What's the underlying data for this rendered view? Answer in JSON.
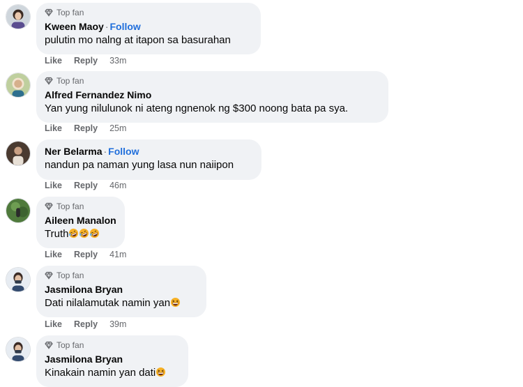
{
  "badge_label": "Top fan",
  "like_label": "Like",
  "reply_label": "Reply",
  "follow_label": "Follow",
  "follow_separator": "·",
  "colors": {
    "bubble": "#f0f2f5",
    "link": "#216fdb",
    "meta": "#65676b",
    "text": "#050505"
  },
  "comments": [
    {
      "name": "Kween Maoy",
      "top_fan": true,
      "follow": true,
      "text": "pulutin mo nalng at itapon sa basurahan",
      "emojis": [],
      "time": "33m"
    },
    {
      "name": "Alfred Fernandez Nimo",
      "top_fan": true,
      "follow": false,
      "text": "Yan yung nilulunok ni ateng ngnenok ng $300 noong bata pa sya.",
      "emojis": [],
      "time": "25m"
    },
    {
      "name": "Ner Belarma",
      "top_fan": false,
      "follow": true,
      "text": "nandun pa naman yung lasa nun naiipon",
      "emojis": [],
      "time": "46m"
    },
    {
      "name": "Aileen Manalon",
      "top_fan": true,
      "follow": false,
      "text": "Truth",
      "emojis": [
        "rolling-laughing-emoji",
        "rolling-laughing-emoji",
        "rolling-laughing-emoji"
      ],
      "time": "41m"
    },
    {
      "name": "Jasmilona Bryan",
      "top_fan": true,
      "follow": false,
      "text": "Dati nilalamutak namin yan",
      "emojis": [
        "grinning-squinting-emoji"
      ],
      "time": "39m"
    },
    {
      "name": "Jasmilona Bryan",
      "top_fan": true,
      "follow": false,
      "text": "Kinakain namin yan dati",
      "emojis": [
        "grinning-squinting-emoji"
      ],
      "time": ""
    }
  ]
}
